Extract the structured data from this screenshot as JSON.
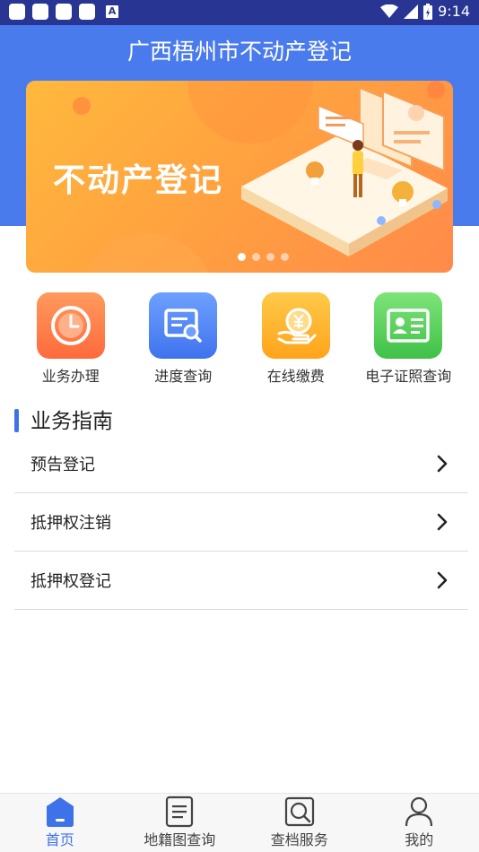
{
  "status_bar": {
    "time": "9:14"
  },
  "header": {
    "title": "广西梧州市不动产登记"
  },
  "banner": {
    "title": "不动产登记",
    "slide_count": 4,
    "active_slide": 1
  },
  "quick_actions": [
    {
      "label": "业务办理",
      "icon": "clock-icon",
      "color": "#ff7a45"
    },
    {
      "label": "进度查询",
      "icon": "document-search-icon",
      "color": "#4c82f5"
    },
    {
      "label": "在线缴费",
      "icon": "yuan-payment-icon",
      "color": "#ffb020"
    },
    {
      "label": "电子证照查询",
      "icon": "id-card-icon",
      "color": "#57cf5b"
    }
  ],
  "guide": {
    "title": "业务指南",
    "items": [
      {
        "label": "预告登记"
      },
      {
        "label": "抵押权注销"
      },
      {
        "label": "抵押权登记"
      }
    ]
  },
  "tab_bar": {
    "tabs": [
      {
        "label": "首页",
        "icon": "home-icon",
        "active": true
      },
      {
        "label": "地籍图查询",
        "icon": "document-icon",
        "active": false
      },
      {
        "label": "查档服务",
        "icon": "search-icon",
        "active": false
      },
      {
        "label": "我的",
        "icon": "user-icon",
        "active": false
      }
    ]
  },
  "colors": {
    "primary": "#4a7bec",
    "status_bar": "#283593",
    "accent": "#3e72e8"
  }
}
